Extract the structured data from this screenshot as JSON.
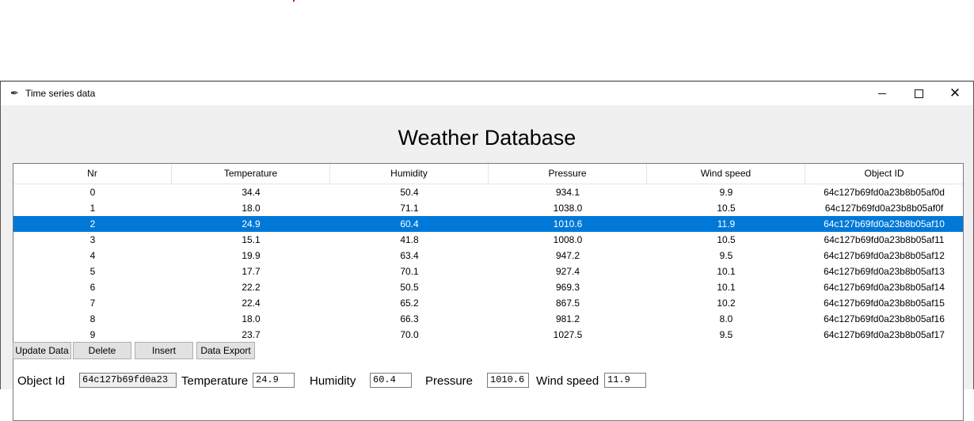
{
  "window": {
    "title": "Time series data"
  },
  "heading": "Weather Database",
  "table": {
    "columns": [
      "Nr",
      "Temperature",
      "Humidity",
      "Pressure",
      "Wind speed",
      "Object ID"
    ],
    "selected_row_index": 2,
    "rows": [
      [
        "0",
        "34.4",
        "50.4",
        "934.1",
        "9.9",
        "64c127b69fd0a23b8b05af0d"
      ],
      [
        "1",
        "18.0",
        "71.1",
        "1038.0",
        "10.5",
        "64c127b69fd0a23b8b05af0f"
      ],
      [
        "2",
        "24.9",
        "60.4",
        "1010.6",
        "11.9",
        "64c127b69fd0a23b8b05af10"
      ],
      [
        "3",
        "15.1",
        "41.8",
        "1008.0",
        "10.5",
        "64c127b69fd0a23b8b05af11"
      ],
      [
        "4",
        "19.9",
        "63.4",
        "947.2",
        "9.5",
        "64c127b69fd0a23b8b05af12"
      ],
      [
        "5",
        "17.7",
        "70.1",
        "927.4",
        "10.1",
        "64c127b69fd0a23b8b05af13"
      ],
      [
        "6",
        "22.2",
        "50.5",
        "969.3",
        "10.1",
        "64c127b69fd0a23b8b05af14"
      ],
      [
        "7",
        "22.4",
        "65.2",
        "867.5",
        "10.2",
        "64c127b69fd0a23b8b05af15"
      ],
      [
        "8",
        "18.0",
        "66.3",
        "981.2",
        "8.0",
        "64c127b69fd0a23b8b05af16"
      ],
      [
        "9",
        "23.7",
        "70.0",
        "1027.5",
        "9.5",
        "64c127b69fd0a23b8b05af17"
      ]
    ]
  },
  "buttons": {
    "update": "Update Data",
    "delete": "Delete",
    "insert": "Insert",
    "export": "Data Export"
  },
  "form": {
    "object_id_label": "Object Id",
    "object_id_value": "64c127b69fd0a23",
    "temperature_label": "Temperature",
    "temperature_value": "24.9",
    "humidity_label": "Humidity",
    "humidity_value": "60.4",
    "pressure_label": "Pressure",
    "pressure_value": "1010.6",
    "wind_label": "Wind speed",
    "wind_value": "11.9"
  },
  "colors": {
    "selection": "#0078d7",
    "window_bg": "#f0f0f0"
  },
  "icons": {
    "app": "feather-icon",
    "minimize": "minimize-icon",
    "maximize": "maximize-icon",
    "close": "close-icon"
  }
}
